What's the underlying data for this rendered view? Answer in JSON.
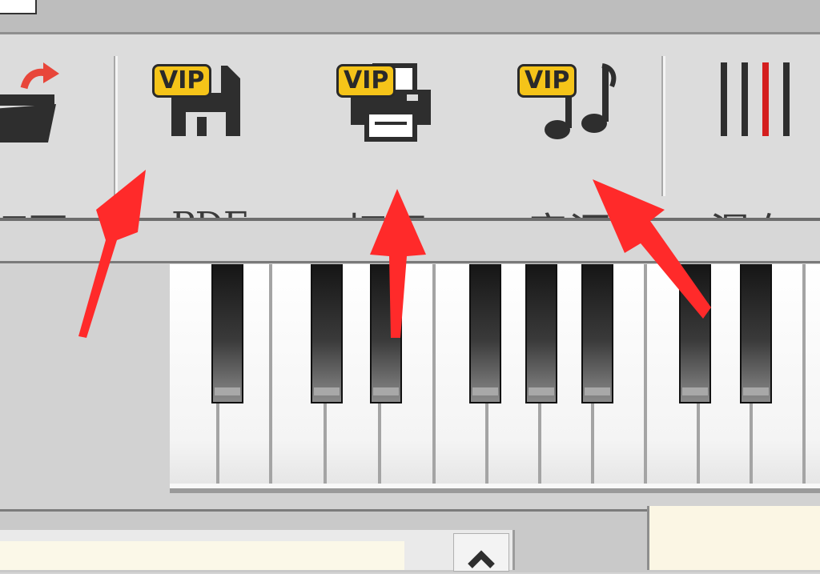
{
  "toolbar": {
    "open_label": "打开",
    "pdf_label": "PDF",
    "print_label": "打印",
    "sound_label": "音源",
    "waterfall_label": "瀑布",
    "vip_badge": "VIP"
  },
  "icons": {
    "open": "open-folder-icon",
    "pdf": "floppy-save-icon",
    "print": "printer-icon",
    "sound": "music-notes-icon",
    "waterfall": "waterfall-bars-icon",
    "scroll_up": "chevron-up-icon"
  },
  "colors": {
    "vip_badge": "#f5c419",
    "annotation_arrow": "#ff2a2a",
    "toolbar_bg": "#dcdcdc",
    "doc_bg": "#fbf8e8"
  }
}
